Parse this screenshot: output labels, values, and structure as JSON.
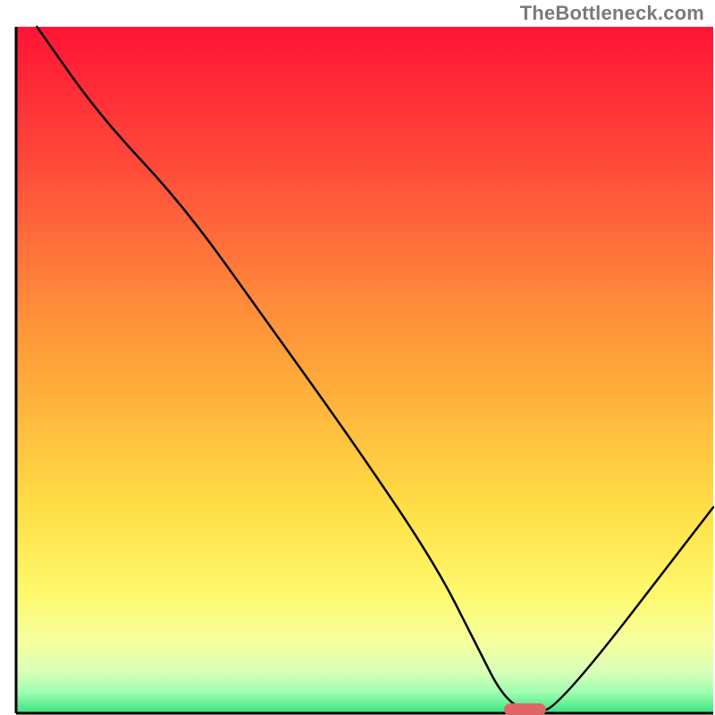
{
  "watermark": "TheBottleneck.com",
  "chart_data": {
    "type": "line",
    "title": "",
    "xlabel": "",
    "ylabel": "",
    "xlim": [
      0,
      100
    ],
    "ylim": [
      0,
      100
    ],
    "x": [
      3,
      12,
      24,
      36,
      48,
      60,
      66,
      70,
      74,
      78,
      100
    ],
    "values": [
      100,
      87,
      74,
      57,
      40,
      22,
      10,
      2,
      0,
      1,
      30
    ],
    "marker": {
      "x_start": 70,
      "x_end": 76,
      "y": 0,
      "color": "#e06666"
    },
    "gradient_stops": [
      {
        "offset": 0.0,
        "color": "#ff1435"
      },
      {
        "offset": 0.2,
        "color": "#ff4a3a"
      },
      {
        "offset": 0.4,
        "color": "#ff8a3a"
      },
      {
        "offset": 0.55,
        "color": "#ffb43c"
      },
      {
        "offset": 0.7,
        "color": "#ffde46"
      },
      {
        "offset": 0.82,
        "color": "#fff86a"
      },
      {
        "offset": 0.9,
        "color": "#f4ffa0"
      },
      {
        "offset": 0.94,
        "color": "#d8ffb8"
      },
      {
        "offset": 0.97,
        "color": "#9dffb0"
      },
      {
        "offset": 1.0,
        "color": "#39e27f"
      }
    ],
    "axis_color": "#000000"
  }
}
